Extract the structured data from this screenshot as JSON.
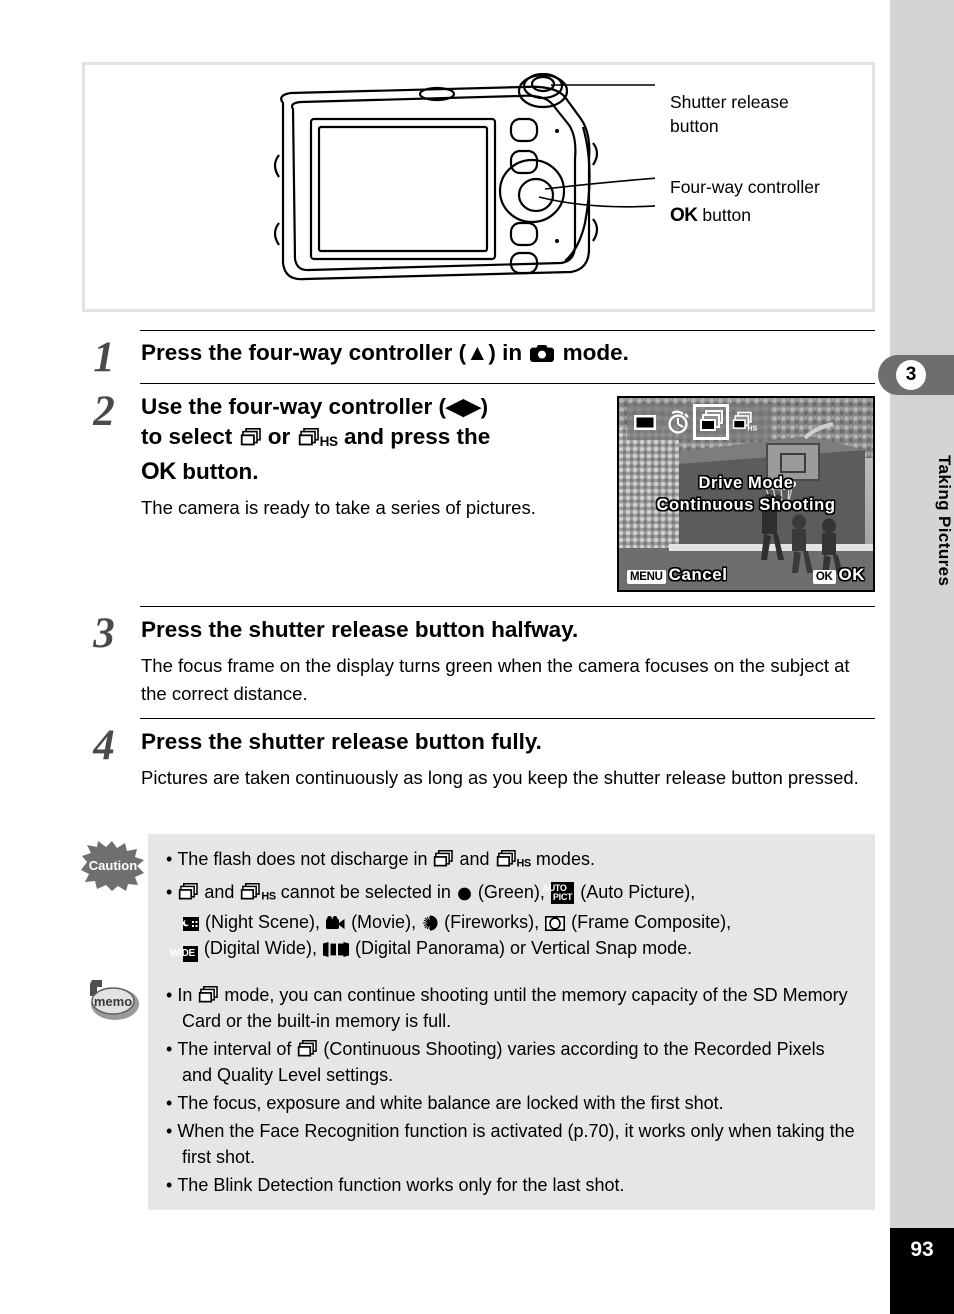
{
  "page": {
    "number": "93",
    "chapter_number": "3",
    "chapter_title": "Taking Pictures"
  },
  "illustration": {
    "name": "camera-rear-view-diagram",
    "callouts": [
      {
        "id": "shutter",
        "label": "Shutter release\nbutton"
      },
      {
        "id": "fourway",
        "label": "Four-way controller"
      },
      {
        "id": "ok",
        "prefix": "OK",
        "label": " button"
      }
    ]
  },
  "steps": [
    {
      "number": "1",
      "heading_parts": [
        "Press the four-way controller (",
        "▲",
        ") in ",
        "[camera-icon]",
        " mode."
      ],
      "heading_plain": "Press the four-way controller (▲) in ■ mode.",
      "body": ""
    },
    {
      "number": "2",
      "heading_plain": "Use the four-way controller (◀▶) to select ❑ or ❑HS and press the OK button.",
      "body": "The camera is ready to take a series of pictures."
    },
    {
      "number": "3",
      "heading_plain": "Press the shutter release button halfway.",
      "body": "The focus frame on the display turns green when the camera focuses on the subject at the correct distance."
    },
    {
      "number": "4",
      "heading_plain": "Press the shutter release button fully.",
      "body": "Pictures are taken continuously as long as you keep the shutter release button pressed."
    }
  ],
  "step2_text": {
    "line1_a": "Use the four-way controller (",
    "line1_arrows": "◀▶",
    "line1_b": ")",
    "line2_a": "to select ",
    "line2_mid": " or ",
    "line2_b": " and press the",
    "line3_ok": "OK",
    "line3_b": " button.",
    "body": "The camera is ready to take a series of pictures."
  },
  "lcd": {
    "title_line1": "Drive Mode",
    "title_line2": "Continuous Shooting",
    "menu_key": "MENU",
    "menu_label": "Cancel",
    "ok_key": "OK",
    "ok_label": "OK",
    "drive_icons": [
      {
        "name": "standard-shooting-icon",
        "selected": false
      },
      {
        "name": "self-timer-icon",
        "selected": false
      },
      {
        "name": "continuous-shooting-icon",
        "selected": true
      },
      {
        "name": "high-speed-continuous-icon",
        "selected": false,
        "sub": "HS"
      }
    ]
  },
  "caution": {
    "badge_label": "Caution",
    "items": [
      "The flash does not discharge in ❑ and ❑HS modes.",
      "❑ and ❑HS cannot be selected in ● (Green), AUTO PICT (Auto Picture), ▣ (Night Scene), ▤ (Movie), ✸ (Fireworks), ◯ (Frame Composite), WIDE (Digital Wide), ▮▮▮ (Digital Panorama) or Vertical Snap mode."
    ],
    "item2_segments": {
      "a": " and ",
      "b": " cannot be selected in ",
      "green": " (Green), ",
      "auto_pict_label": " (Auto Picture),",
      "night_scene": " (Night Scene), ",
      "movie": " (Movie), ",
      "fireworks": " (Fireworks), ",
      "frame_composite": " (Frame Composite),",
      "digital_wide": " (Digital Wide), ",
      "digital_panorama": " (Digital Panorama) or Vertical Snap mode."
    },
    "glyph_labels": {
      "auto_top": "AUTO",
      "auto_bottom": "PICT",
      "wide": "WIDE"
    }
  },
  "memo": {
    "badge_label": "memo",
    "items": [
      "In ❑ mode, you can continue shooting until the memory capacity of the SD Memory Card or the built-in memory is full.",
      "The interval of ❑ (Continuous Shooting) varies according to the Recorded Pixels and Quality Level settings.",
      "The focus, exposure and white balance are locked with the first shot.",
      "When the Face Recognition function is activated (p.70), it works only when taking the first shot.",
      "The Blink Detection function works only for the last shot."
    ],
    "item1_a": "In ",
    "item1_b": " mode, you can continue shooting until the memory capacity of the SD Memory Card or the built-in memory is full.",
    "item2_a": "The interval of ",
    "item2_b": " (Continuous Shooting) varies according to the Recorded Pixels and Quality Level settings.",
    "item3": "The focus, exposure and white balance are locked with the first shot.",
    "item4": "When the Face Recognition function is activated (p.70), it works only when taking the first shot.",
    "item5": "The Blink Detection function works only for the last shot."
  },
  "colors": {
    "sidebar_bg": "#d4d4d4",
    "chapter_tab": "#6e6e6e",
    "note_bg": "#e6e6e6",
    "step_number": "#4a4a4a",
    "page_block": "#000000"
  }
}
